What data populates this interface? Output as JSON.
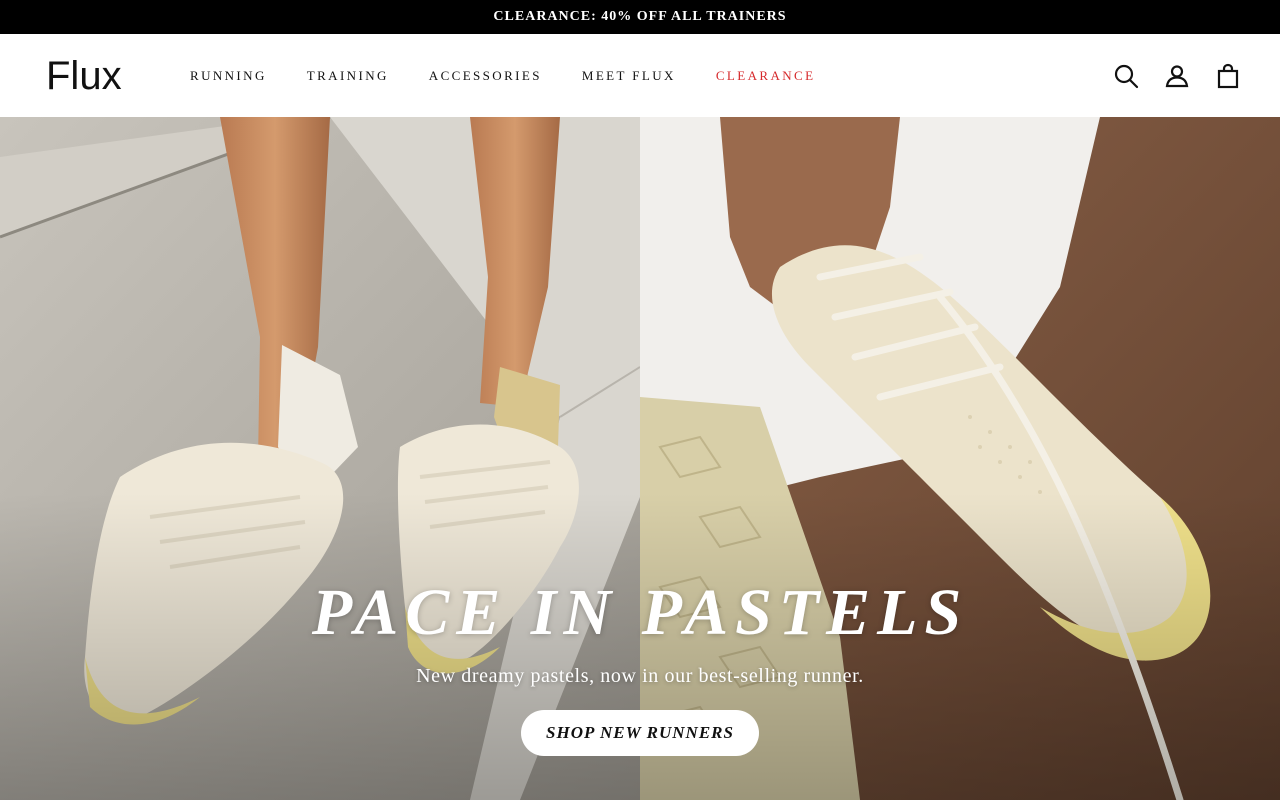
{
  "announcement": {
    "text": "CLEARANCE: 40% OFF ALL TRAINERS"
  },
  "brand": {
    "logo_text": "Flux"
  },
  "nav": {
    "items": [
      {
        "label": "RUNNING"
      },
      {
        "label": "TRAINING"
      },
      {
        "label": "ACCESSORIES"
      },
      {
        "label": "MEET FLUX"
      },
      {
        "label": "CLEARANCE"
      }
    ]
  },
  "header_icons": [
    "search-icon",
    "account-icon",
    "cart-icon"
  ],
  "hero": {
    "title": "PACE IN PASTELS",
    "subtitle": "New dreamy pastels, now in our best-selling runner.",
    "cta_label": "SHOP NEW RUNNERS"
  },
  "colors": {
    "announcement_bg": "#000000",
    "accent_sale": "#d6292b",
    "text": "#111111",
    "shoe_cream": "#ede4cf",
    "sole_yellow": "#efe08a"
  }
}
